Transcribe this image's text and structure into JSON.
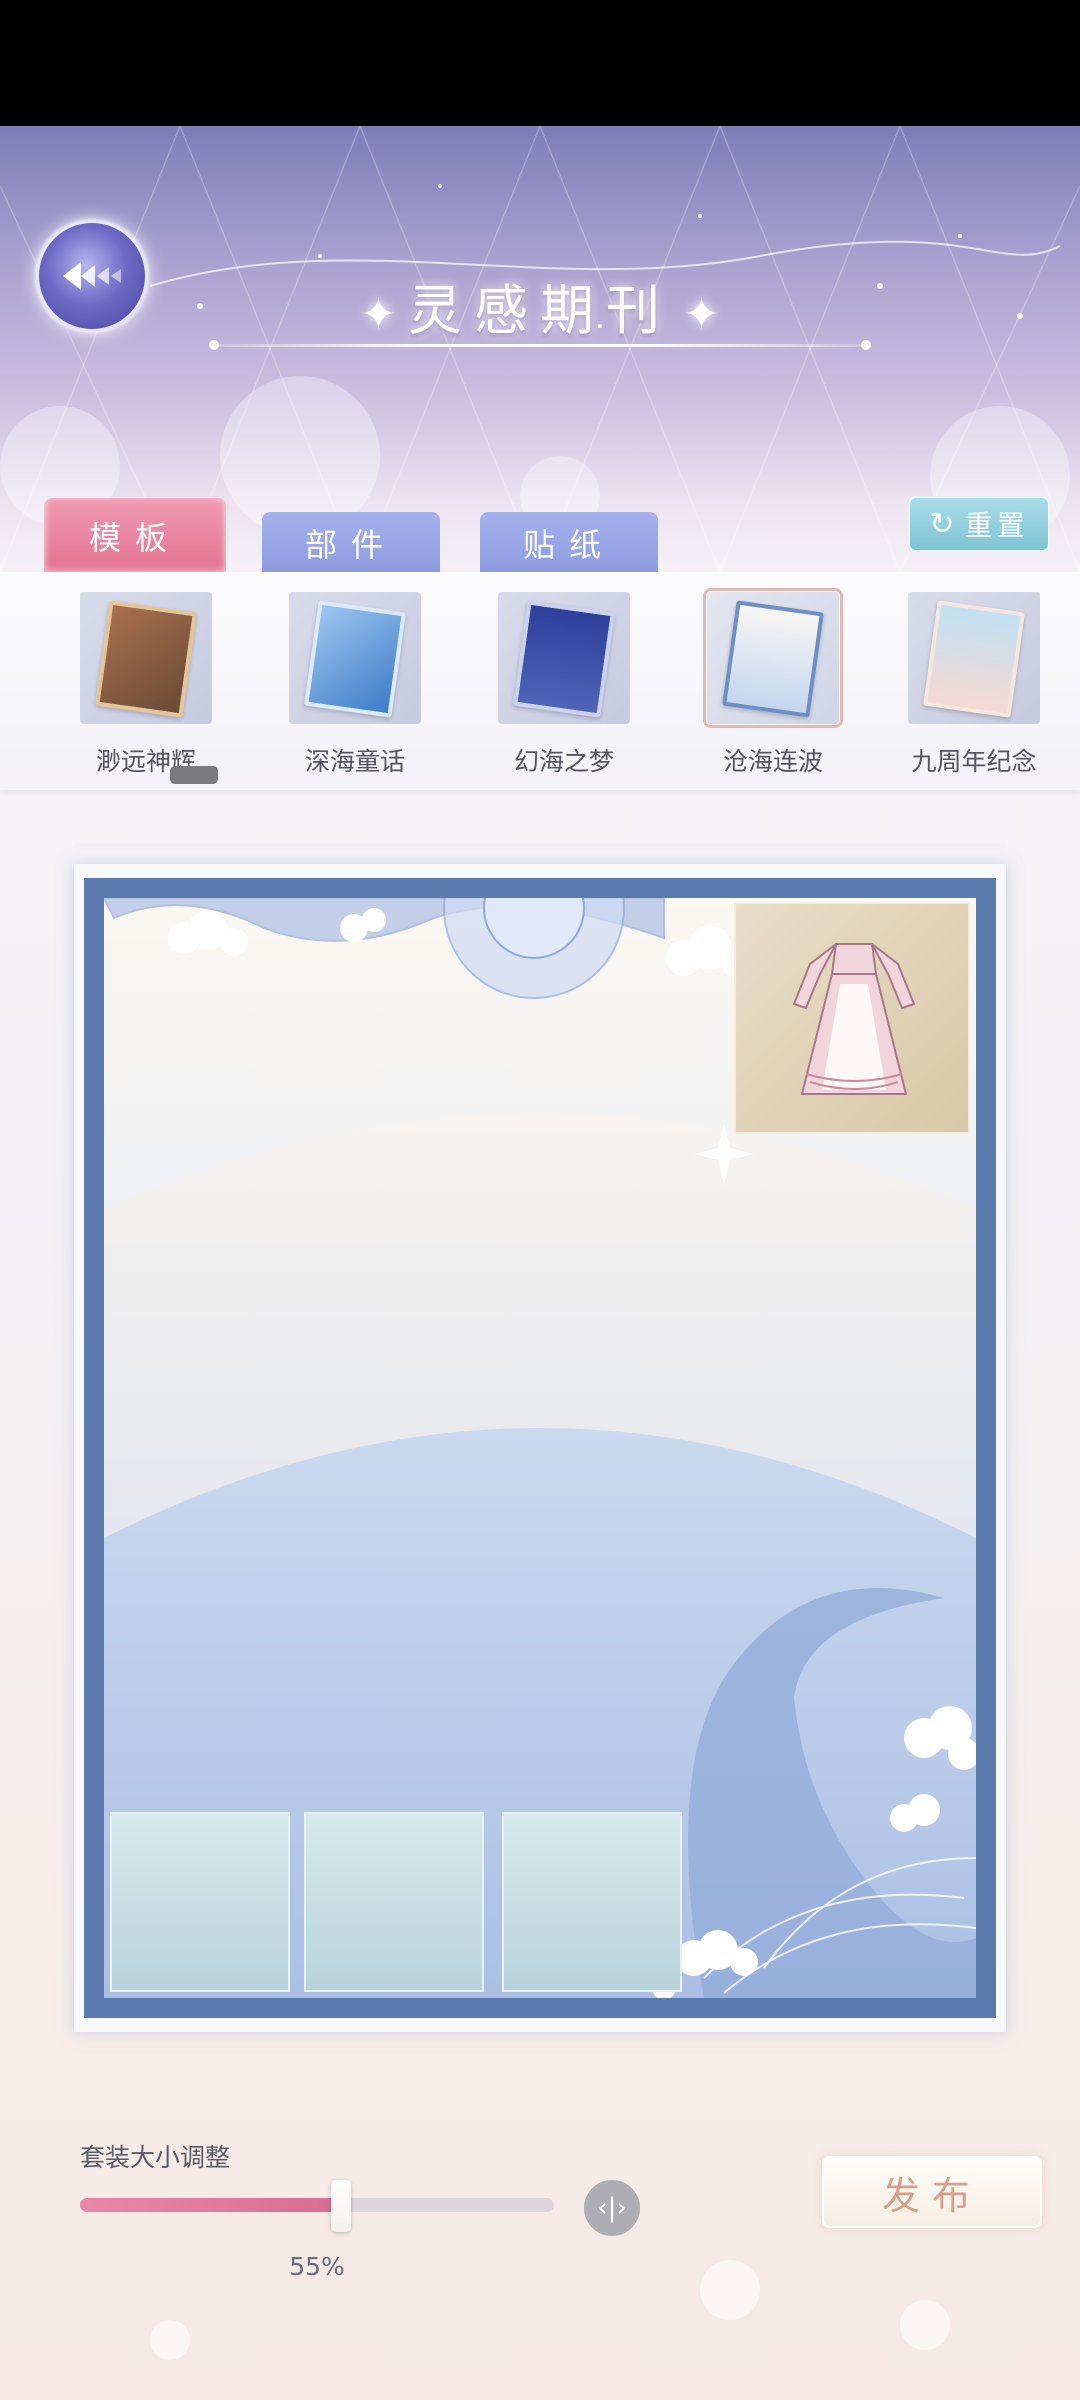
{
  "header": {
    "title": "灵感期刊",
    "title_star": "✦"
  },
  "tabs": [
    {
      "label": "模板",
      "active": true
    },
    {
      "label": "部件",
      "active": false
    },
    {
      "label": "贴纸",
      "active": false
    }
  ],
  "reset": {
    "icon": "refresh-icon",
    "label": "重置"
  },
  "templates": [
    {
      "label": "渺远神辉",
      "color": "#8b6a4f",
      "selected": false
    },
    {
      "label": "深海童话",
      "color": "#5a8fd0",
      "selected": false
    },
    {
      "label": "幻海之梦",
      "color": "#2d3f9a",
      "selected": false
    },
    {
      "label": "沧海连波",
      "color": "#e9eef8",
      "selected": true
    },
    {
      "label": "九周年纪念",
      "color": "#f1d6d2",
      "selected": false
    }
  ],
  "size_control": {
    "label": "套装大小调整",
    "value_text": "55%",
    "value": 0.55,
    "toggle_icon": "split-arrows-icon"
  },
  "publish_label": "发布",
  "colors": {
    "accent_pink": "#e0708f",
    "tab_blue": "#8d9ae0",
    "frame_blue": "#5a79ad",
    "reset_teal": "#7fc3d4"
  }
}
